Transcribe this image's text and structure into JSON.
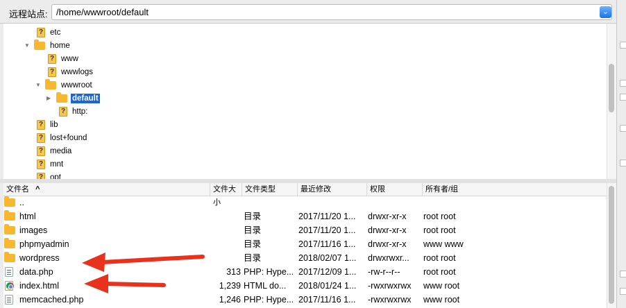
{
  "remote_site": {
    "label": "远程站点:",
    "path": "/home/wwwroot/default",
    "dropdown_glyph": "⌄"
  },
  "tree": {
    "items": [
      {
        "label": "etc",
        "icon": "question-folder-icon",
        "expanded": null,
        "selected": false
      },
      {
        "label": "home",
        "icon": "folder-icon",
        "expanded": true,
        "selected": false
      },
      {
        "label": "www",
        "icon": "question-folder-icon",
        "expanded": null,
        "selected": false
      },
      {
        "label": "wwwlogs",
        "icon": "question-folder-icon",
        "expanded": null,
        "selected": false
      },
      {
        "label": "wwwroot",
        "icon": "folder-icon",
        "expanded": true,
        "selected": false
      },
      {
        "label": "default",
        "icon": "folder-icon",
        "expanded": false,
        "selected": true
      },
      {
        "label": "http:",
        "icon": "question-folder-icon",
        "expanded": null,
        "selected": false
      },
      {
        "label": "lib",
        "icon": "question-folder-icon",
        "expanded": null,
        "selected": false
      },
      {
        "label": "lost+found",
        "icon": "question-folder-icon",
        "expanded": null,
        "selected": false
      },
      {
        "label": "media",
        "icon": "question-folder-icon",
        "expanded": null,
        "selected": false
      },
      {
        "label": "mnt",
        "icon": "question-folder-icon",
        "expanded": null,
        "selected": false
      },
      {
        "label": "opt",
        "icon": "question-folder-icon",
        "expanded": null,
        "selected": false
      }
    ]
  },
  "file_list": {
    "columns": {
      "name": "文件名",
      "sort_indicator": "^",
      "size": "文件大小",
      "type": "文件类型",
      "modified": "最近修改",
      "permissions": "权限",
      "owner": "所有者/组"
    },
    "rows": [
      {
        "name": "..",
        "icon": "folder-icon",
        "size": "",
        "type": "",
        "modified": "",
        "permissions": "",
        "owner": ""
      },
      {
        "name": "html",
        "icon": "folder-icon",
        "size": "",
        "type": "目录",
        "modified": "2017/11/20 1...",
        "permissions": "drwxr-xr-x",
        "owner": "root root"
      },
      {
        "name": "images",
        "icon": "folder-icon",
        "size": "",
        "type": "目录",
        "modified": "2017/11/20 1...",
        "permissions": "drwxr-xr-x",
        "owner": "root root"
      },
      {
        "name": "phpmyadmin",
        "icon": "folder-icon",
        "size": "",
        "type": "目录",
        "modified": "2017/11/16 1...",
        "permissions": "drwxr-xr-x",
        "owner": "www www"
      },
      {
        "name": "wordpress",
        "icon": "folder-icon",
        "size": "",
        "type": "目录",
        "modified": "2018/02/07 1...",
        "permissions": "drwxrwxr...",
        "owner": "root root"
      },
      {
        "name": "data.php",
        "icon": "php-file-icon",
        "size": "313",
        "type": "PHP: Hype...",
        "modified": "2017/12/09 1...",
        "permissions": "-rw-r--r--",
        "owner": "root root"
      },
      {
        "name": "index.html",
        "icon": "chrome-html-icon",
        "size": "1,239",
        "type": "HTML do...",
        "modified": "2018/01/24 1...",
        "permissions": "-rwxrwxrwx",
        "owner": "www root"
      },
      {
        "name": "memcached.php",
        "icon": "php-file-icon",
        "size": "1,246",
        "type": "PHP: Hype...",
        "modified": "2017/11/16 1...",
        "permissions": "-rwxrwxrwx",
        "owner": "www root"
      }
    ]
  },
  "annotations": {
    "arrow_color": "#e8321e",
    "arrows": [
      "red-arrow-to-wordpress",
      "red-arrow-to-index-html"
    ]
  },
  "colors": {
    "selection": "#1c64d6",
    "folder": "#f7b731",
    "accent_blue": "#1a73e8"
  }
}
